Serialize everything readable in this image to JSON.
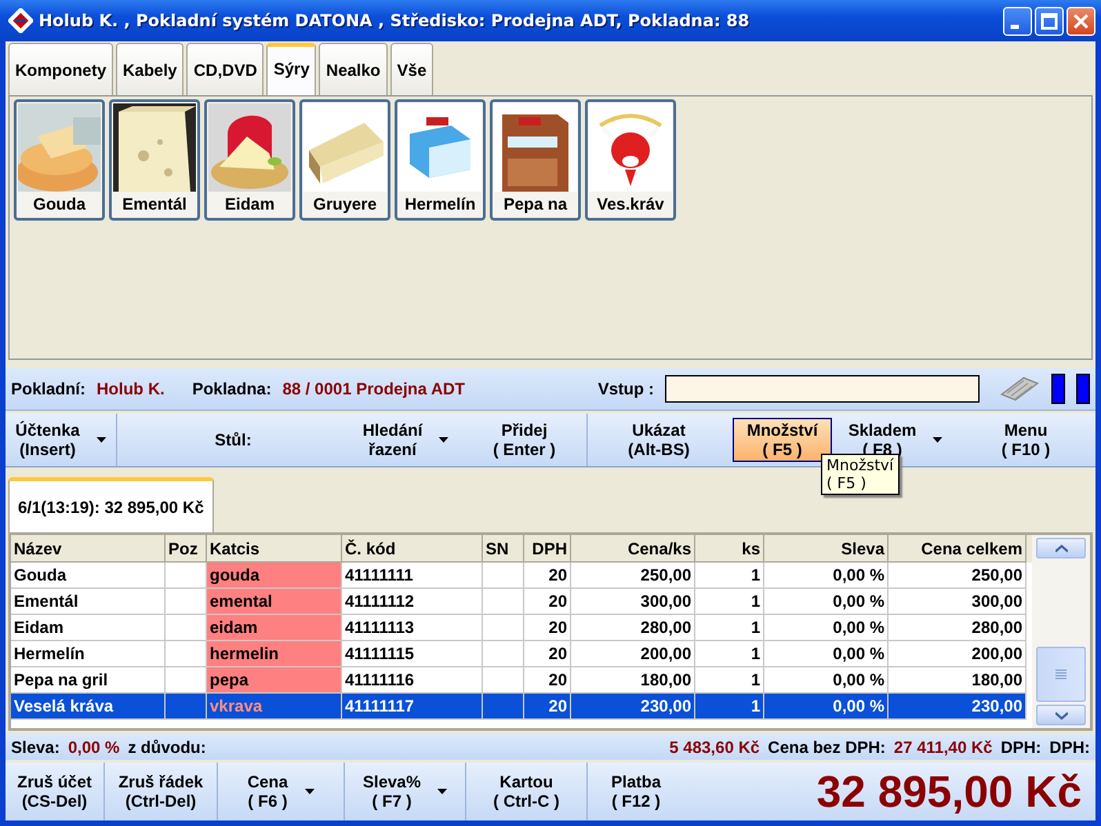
{
  "window": {
    "title": "Holub K. , Pokladní systém DATONA , Středisko: Prodejna ADT, Pokladna: 88"
  },
  "category_tabs": [
    {
      "label": "Komponety",
      "selected": false
    },
    {
      "label": "Kabely",
      "selected": false
    },
    {
      "label": "CD,DVD",
      "selected": false
    },
    {
      "label": "Sýry",
      "selected": true
    },
    {
      "label": "Nealko",
      "selected": false
    },
    {
      "label": "Vše",
      "selected": false
    }
  ],
  "products": [
    {
      "label": "Gouda",
      "kind": "picture"
    },
    {
      "label": "Ementál",
      "kind": "picture"
    },
    {
      "label": "Eidam",
      "kind": "picture"
    },
    {
      "label": "Gruyere",
      "kind": "picture"
    },
    {
      "label": "Hermelín",
      "kind": "picture"
    },
    {
      "label": "Pepa na",
      "kind": "picture"
    },
    {
      "label": "Ves.kráv",
      "kind": "picture"
    }
  ],
  "info_bar": {
    "cashier_label": "Pokladní:",
    "cashier": "Holub K.",
    "register_label": "Pokladna:",
    "register": "88 / 0001 Prodejna ADT",
    "input_label": "Vstup :"
  },
  "toolbar": [
    {
      "kind": "button",
      "lines": [
        "Účtenka",
        "(Insert)"
      ],
      "dropdown": true,
      "active": false
    },
    {
      "kind": "label",
      "lines": [
        "Stůl:"
      ]
    },
    {
      "kind": "button",
      "lines": [
        "Hledání",
        "řazení"
      ],
      "dropdown": true,
      "active": false
    },
    {
      "kind": "button",
      "lines": [
        "Přidej",
        "( Enter )"
      ],
      "dropdown": false,
      "active": false
    },
    {
      "kind": "button",
      "lines": [
        "Ukázat",
        "(Alt-BS)"
      ],
      "dropdown": false,
      "active": false
    },
    {
      "kind": "button",
      "lines": [
        "Množství",
        "( F5 )"
      ],
      "dropdown": false,
      "active": true
    },
    {
      "kind": "button",
      "lines": [
        "Skladem",
        "( F8 )"
      ],
      "dropdown": true,
      "active": false
    },
    {
      "kind": "button",
      "lines": [
        "Menu",
        "( F10 )"
      ],
      "dropdown": false,
      "active": false
    }
  ],
  "tooltip": {
    "lines": [
      "Množství",
      "( F5 )"
    ]
  },
  "receipt_tabs": [
    {
      "label": "6/1(13:19): 32 895,00 Kč",
      "selected": true
    }
  ],
  "table": {
    "columns": [
      "Název",
      "Poz",
      "Katcis",
      "Č. kód",
      "SN",
      "DPH",
      "Cena/ks",
      "ks",
      "Sleva",
      "Cena celkem"
    ],
    "rows": [
      {
        "cells": [
          "Gouda",
          "",
          "gouda",
          "41111111",
          "",
          "20",
          "250,00",
          "1",
          "0,00 %",
          "250,00"
        ],
        "selected": false
      },
      {
        "cells": [
          "Ementál",
          "",
          "emental",
          "41111112",
          "",
          "20",
          "300,00",
          "1",
          "0,00 %",
          "300,00"
        ],
        "selected": false
      },
      {
        "cells": [
          "Eidam",
          "",
          "eidam",
          "41111113",
          "",
          "20",
          "280,00",
          "1",
          "0,00 %",
          "280,00"
        ],
        "selected": false
      },
      {
        "cells": [
          "Hermelín",
          "",
          "hermelin",
          "41111115",
          "",
          "20",
          "200,00",
          "1",
          "0,00 %",
          "200,00"
        ],
        "selected": false
      },
      {
        "cells": [
          "Pepa na gril",
          "",
          "pepa",
          "41111116",
          "",
          "20",
          "180,00",
          "1",
          "0,00 %",
          "180,00"
        ],
        "selected": false
      },
      {
        "cells": [
          "Veselá kráva",
          "",
          "vkrava",
          "41111117",
          "",
          "20",
          "230,00",
          "1",
          "0,00 %",
          "230,00"
        ],
        "selected": true
      }
    ]
  },
  "summary": {
    "left": [
      {
        "kind": "label",
        "text": "Sleva:"
      },
      {
        "kind": "value",
        "text": "0,00 %"
      },
      {
        "kind": "label",
        "text": "z důvodu:"
      }
    ],
    "right": [
      {
        "kind": "value",
        "text": "5 483,60 Kč"
      },
      {
        "kind": "label",
        "text": "Cena bez DPH:"
      },
      {
        "kind": "value",
        "text": "27 411,40 Kč"
      },
      {
        "kind": "label",
        "text": "DPH:"
      },
      {
        "kind": "label",
        "text": "DPH:"
      }
    ]
  },
  "bottom_bar": {
    "buttons": [
      {
        "lines": [
          "Zruš účet",
          "(CS-Del)"
        ],
        "dropdown": false
      },
      {
        "lines": [
          "Zruš řádek",
          "(Ctrl-Del)"
        ],
        "dropdown": false
      },
      {
        "lines": [
          "Cena",
          "( F6 )"
        ],
        "dropdown": true
      },
      {
        "lines": [
          "Sleva%",
          "( F7 )"
        ],
        "dropdown": true
      },
      {
        "lines": [
          "Kartou",
          "( Ctrl-C )"
        ],
        "dropdown": false
      },
      {
        "lines": [
          "Platba",
          "( F12 )"
        ],
        "dropdown": false
      }
    ],
    "total": "32 895,00 Kč"
  }
}
